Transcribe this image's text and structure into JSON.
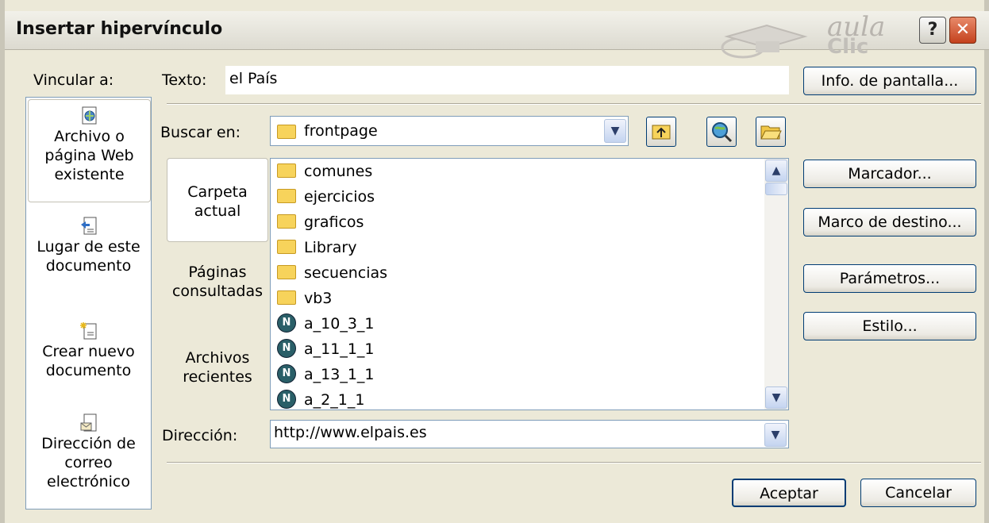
{
  "window": {
    "title": "Insertar hipervínculo",
    "help_label": "?",
    "close_label": "✕"
  },
  "logo": {
    "line1": "aula",
    "line2": "Clic"
  },
  "link_to": {
    "label": "Vincular a:",
    "items": [
      {
        "lines": [
          "Archivo o",
          "página Web",
          "existente"
        ],
        "icon": "web-file-icon",
        "selected": true
      },
      {
        "lines": [
          "Lugar de este",
          "documento"
        ],
        "icon": "place-in-document-icon",
        "selected": false
      },
      {
        "lines": [
          "Crear nuevo",
          "documento"
        ],
        "icon": "new-document-icon",
        "selected": false
      },
      {
        "lines": [
          "Dirección de",
          "correo",
          "electrónico"
        ],
        "icon": "email-address-icon",
        "selected": false
      }
    ]
  },
  "text_field": {
    "label": "Texto:",
    "value": "el País"
  },
  "screen_tip_button": "Info. de pantalla...",
  "look_in": {
    "label": "Buscar en:",
    "value": "frontpage"
  },
  "nav": {
    "items": [
      {
        "lines": [
          "Carpeta",
          "actual"
        ],
        "selected": true
      },
      {
        "lines": [
          "Páginas",
          "consultadas"
        ],
        "selected": false
      },
      {
        "lines": [
          "Archivos",
          "recientes"
        ],
        "selected": false
      }
    ]
  },
  "files": [
    {
      "name": "comunes",
      "type": "folder"
    },
    {
      "name": "ejercicios",
      "type": "folder"
    },
    {
      "name": "graficos",
      "type": "folder"
    },
    {
      "name": "Library",
      "type": "folder"
    },
    {
      "name": "secuencias",
      "type": "folder"
    },
    {
      "name": "vb3",
      "type": "folder"
    },
    {
      "name": "a_10_3_1",
      "type": "page"
    },
    {
      "name": "a_11_1_1",
      "type": "page"
    },
    {
      "name": "a_13_1_1",
      "type": "page"
    },
    {
      "name": "a_2_1_1",
      "type": "page"
    }
  ],
  "side_buttons": {
    "bookmark": "Marcador...",
    "target_frame": "Marco de destino...",
    "parameters": "Parámetros...",
    "style": "Estilo..."
  },
  "address": {
    "label": "Dirección:",
    "value": "http://www.elpais.es"
  },
  "footer": {
    "ok": "Aceptar",
    "cancel": "Cancelar"
  }
}
